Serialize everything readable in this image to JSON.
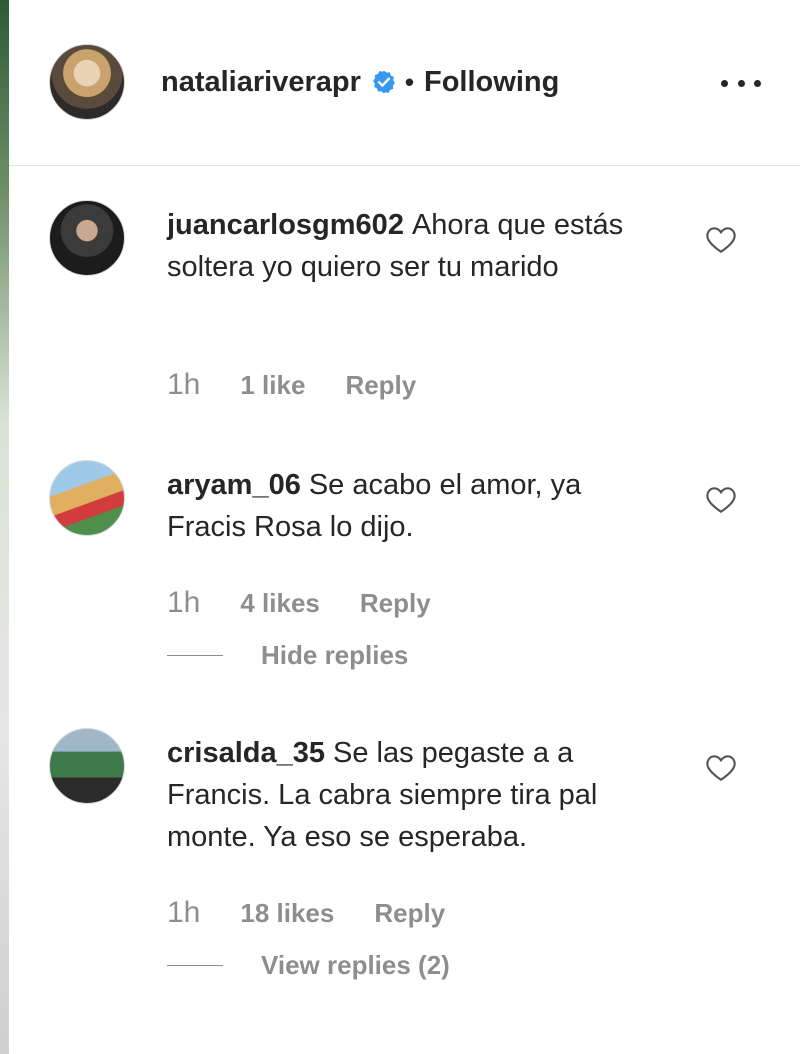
{
  "header": {
    "username": "nataliariverapr",
    "separator": "•",
    "follow_status": "Following",
    "verified_icon": "verified-badge-icon",
    "more_icon": "more-options-icon"
  },
  "comments": [
    {
      "username": "juancarlosgm602",
      "text": "Ahora que estás soltera yo quiero ser tu marido",
      "time": "1h",
      "likes": "1 like",
      "reply_label": "Reply"
    },
    {
      "username": "aryam_06",
      "text": "Se acabo el amor, ya Fracis Rosa lo dijo.",
      "time": "1h",
      "likes": "4 likes",
      "reply_label": "Reply",
      "replies_toggle": "Hide replies"
    },
    {
      "username": "crisalda_35",
      "text": "Se las pegaste a a Francis. La cabra siempre tira pal monte. Ya eso se esperaba.",
      "time": "1h",
      "likes": "18 likes",
      "reply_label": "Reply",
      "replies_toggle": "View replies (2)"
    }
  ],
  "colors": {
    "text": "#262626",
    "secondary": "#8e8e8e",
    "verified": "#3897f0",
    "divider": "#e3e3e3"
  }
}
